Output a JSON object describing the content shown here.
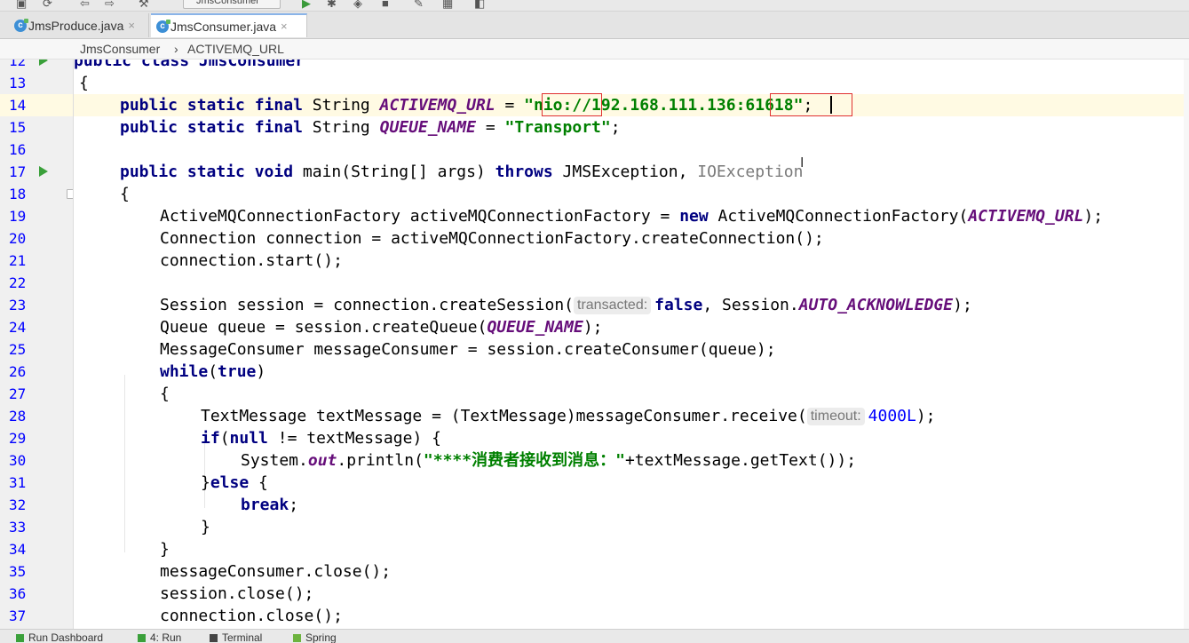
{
  "toolbar": {
    "run_config": "JmsConsumer"
  },
  "tabs": [
    {
      "label": "JmsProduce.java",
      "active": false
    },
    {
      "label": "JmsConsumer.java",
      "active": true
    }
  ],
  "tab_close_glyph": "×",
  "breadcrumb": {
    "class_name": "JmsConsumer",
    "separator": "›",
    "field_name": "ACTIVEMQ_URL"
  },
  "gutter": {
    "line_numbers": [
      "12",
      "13",
      "14",
      "15",
      "16",
      "17",
      "18",
      "19",
      "20",
      "21",
      "22",
      "23",
      "24",
      "25",
      "26",
      "27",
      "28",
      "29",
      "30",
      "31",
      "32",
      "33",
      "34",
      "35",
      "36",
      "37"
    ]
  },
  "code": {
    "l12": "public class JmsConsumer",
    "l13": "{",
    "l14": {
      "mod": "public static final",
      "type": " String ",
      "field": "ACTIVEMQ_URL",
      "eq": " = ",
      "value": "\"nio://192.168.111.136:61618\"",
      "end": ";"
    },
    "l15": {
      "mod": "public static final",
      "type": " String ",
      "field": "QUEUE_NAME",
      "eq": " = ",
      "value": "\"Transport\"",
      "end": ";"
    },
    "l17": {
      "mod": "public static void",
      "sig": " main(String[] args) ",
      "throws": "throws",
      "exc1": " JMSException, ",
      "exc2": "IOException"
    },
    "l18": "{",
    "l19": {
      "a": "ActiveMQConnectionFactory activeMQConnectionFactory = ",
      "new": "new",
      "b": " ActiveMQConnectionFactory(",
      "c": "ACTIVEMQ_URL",
      "d": ");"
    },
    "l20": "Connection connection = activeMQConnectionFactory.createConnection();",
    "l21": "connection.start();",
    "l23": {
      "a": "Session session = connection.createSession(",
      "hint": "transacted:",
      "kw": "false",
      "b": ", Session.",
      "c": "AUTO_ACKNOWLEDGE",
      "d": ");"
    },
    "l24": {
      "a": "Queue queue = session.createQueue(",
      "c": "QUEUE_NAME",
      "d": ");"
    },
    "l25": "MessageConsumer messageConsumer = session.createConsumer(queue);",
    "l26": {
      "kw": "while",
      "a": "(",
      "kw2": "true",
      "b": ")"
    },
    "l27": "{",
    "l28": {
      "a": "TextMessage textMessage = (TextMessage)messageConsumer.receive(",
      "hint": "timeout:",
      "num": "4000L",
      "d": ");"
    },
    "l29": {
      "kw": "if",
      "a": "(",
      "kw2": "null",
      "b": " != textMessage) {"
    },
    "l30": {
      "a": "System.",
      "c": "out",
      "b": ".println(",
      "str": "\"****消费者接收到消息：\"",
      "d": "+textMessage.getText());"
    },
    "l31": {
      "a": "}",
      "kw": "else",
      "b": " {"
    },
    "l32": {
      "kw": "break",
      "d": ";"
    },
    "l33": "}",
    "l34": "}",
    "l35": "messageConsumer.close();",
    "l36": "session.close();",
    "l37": "connection.close();"
  },
  "bottom_bar": [
    {
      "label": "Run Dashboard"
    },
    {
      "label": "4: Run"
    },
    {
      "label": "Terminal"
    },
    {
      "label": "Spring"
    }
  ]
}
